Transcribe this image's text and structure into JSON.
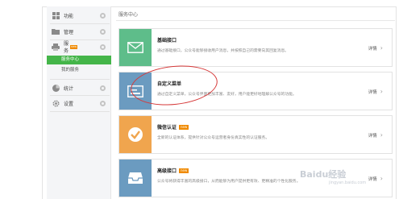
{
  "sidebar": {
    "items": [
      {
        "label": "功能",
        "icon": "grid-icon"
      },
      {
        "label": "管理",
        "icon": "folder-icon"
      },
      {
        "label": "服务",
        "icon": "printer-icon",
        "badge": "new"
      },
      {
        "label": "统计",
        "icon": "pie-icon"
      },
      {
        "label": "设置",
        "icon": "settings-icon"
      }
    ],
    "sub_items": [
      {
        "label": "服务中心",
        "active": true
      },
      {
        "label": "我的服务",
        "active": false
      }
    ]
  },
  "main": {
    "title": "服务中心",
    "cards": [
      {
        "title": "基础接口",
        "badge": "",
        "desc": "通过基础接口，公众号能够接收用户消息，并按照自己的需要向其回复消息。",
        "detail": "详情",
        "color": "#5ebd8a",
        "icon": "mail-icon"
      },
      {
        "title": "自定义菜单",
        "badge": "",
        "desc": "通过自定义菜单，公众号界面更加丰富、友好，用户能更好地理解公众号的功能。",
        "detail": "详情",
        "color": "#6b9bc0",
        "icon": "menu-screen-icon"
      },
      {
        "title": "微信认证",
        "badge": "new",
        "desc": "全新的认证体系，提供针对公众号运营者身份真实性的认证服务。",
        "detail": "详情",
        "color": "#f0a54e",
        "icon": "check-icon"
      },
      {
        "title": "高级接口",
        "badge": "new",
        "desc": "公众号将获得丰富的高级接口，从而能够为用户提供更有效、更精准的个性化服务。",
        "detail": "详情",
        "color": "#6b9bc0",
        "icon": "inbox-icon"
      }
    ]
  },
  "watermark": {
    "text": "Baidu经验",
    "sub": "jingyan.baidu.com"
  },
  "colors": {
    "active_green": "#44b549",
    "annotation_red": "#d63a3a"
  }
}
